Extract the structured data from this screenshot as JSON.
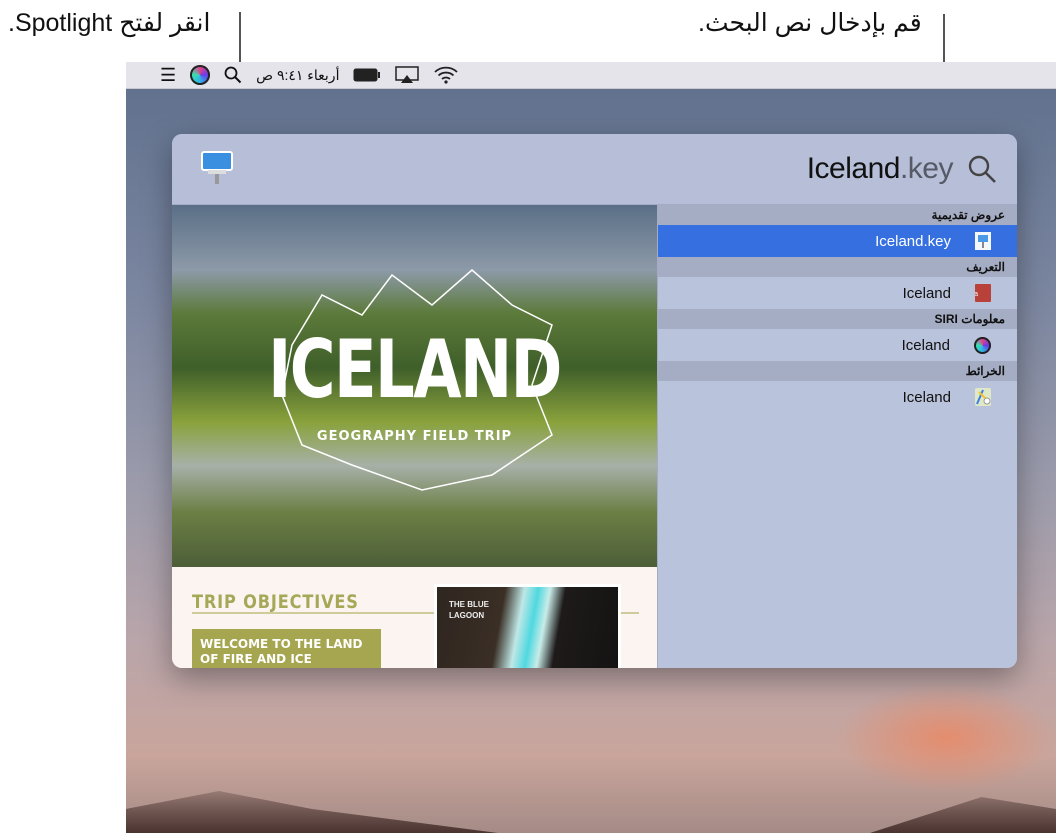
{
  "callouts": {
    "spotlight": "انقر لفتح Spotlight.",
    "search": "قم بإدخال نص البحث."
  },
  "menubar": {
    "datetime": "أربعاء ٩:٤١ ص",
    "icons": [
      "control-center-icon",
      "siri-icon",
      "spotlight-search-icon",
      "battery-icon",
      "airplay-icon",
      "wifi-icon"
    ]
  },
  "spotlight": {
    "query_typed": "Iceland",
    "query_completion": ".key",
    "preview": {
      "title": "ICELAND",
      "subtitle": "GEOGRAPHY FIELD TRIP",
      "objectives": "TRIP OBJECTIVES",
      "welcome": "WELCOME TO THE LAND OF FIRE AND ICE",
      "lagoon": "THE BLUE LAGOON"
    },
    "sections": [
      {
        "header": "عروض تقديمية",
        "items": [
          {
            "label": "Iceland.key",
            "icon": "keynote-icon",
            "selected": true
          }
        ]
      },
      {
        "header": "التعريف",
        "items": [
          {
            "label": "Iceland",
            "icon": "dictionary-icon"
          }
        ]
      },
      {
        "header": "معلومات SIRI",
        "items": [
          {
            "label": "Iceland",
            "icon": "siri-icon"
          }
        ]
      },
      {
        "header": "الخرائط",
        "items": [
          {
            "label": "Iceland",
            "icon": "maps-icon"
          }
        ]
      }
    ]
  },
  "colors": {
    "selection": "#3670e0",
    "accent_olive": "#a6a650"
  }
}
